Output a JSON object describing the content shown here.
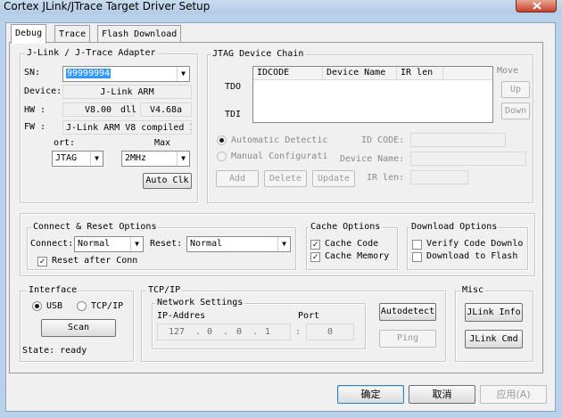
{
  "window": {
    "title": "Cortex JLink/JTrace Target Driver Setup"
  },
  "tabs": [
    {
      "label": "Debug",
      "active": true
    },
    {
      "label": "Trace",
      "active": false
    },
    {
      "label": "Flash Download",
      "active": false
    }
  ],
  "adapter": {
    "legend": "J-Link / J-Trace Adapter",
    "sn_label": "SN:",
    "sn_value": "99999994",
    "device_label": "Device:",
    "device_value": "J-Link ARM",
    "hw_label": "HW :",
    "hw_value": "V8.00",
    "dll_label": "dll",
    "dll_value": "V4.68a",
    "fw_label": "FW :",
    "fw_value": "J-Link ARM V8 compiled I",
    "port_label": "ort:",
    "port_value": "JTAG",
    "max_label": "Max",
    "max_value": "2MHz",
    "auto_clk": "Auto Clk"
  },
  "jtag": {
    "legend": "JTAG Device Chain",
    "columns": [
      "IDCODE",
      "Device Name",
      "IR len"
    ],
    "tdo": "TDO",
    "tdi": "TDI",
    "move_label": "Move",
    "up": "Up",
    "down": "Down",
    "auto_detect": "Automatic Detectic",
    "manual_config": "Manual Configurati",
    "id_code_label": "ID CODE:",
    "device_name_label": "Device Name:",
    "ir_len_label": "IR len:",
    "add": "Add",
    "delete": "Delete",
    "update": "Update"
  },
  "connect": {
    "legend": "Connect & Reset Options",
    "connect_label": "Connect:",
    "connect_value": "Normal",
    "reset_label": "Reset:",
    "reset_value": "Normal",
    "reset_after": "Reset after Conn",
    "reset_after_checked": true
  },
  "cache": {
    "legend": "Cache Options",
    "code": "Cache Code",
    "code_checked": true,
    "memory": "Cache Memory",
    "memory_checked": true
  },
  "download": {
    "legend": "Download Options",
    "verify": "Verify Code Downlo",
    "verify_checked": false,
    "flash": "Download to Flash",
    "flash_checked": false
  },
  "interface": {
    "legend": "Interface",
    "usb": "USB",
    "tcpip": "TCP/IP",
    "selected": "USB",
    "scan": "Scan",
    "state": "State: ready"
  },
  "tcp": {
    "legend": "TCP/IP",
    "net_legend": "Network Settings",
    "ip_label": "IP-Addres",
    "port_label": "Port",
    "ip": [
      "127",
      "0",
      "0",
      "1"
    ],
    "port": "0",
    "autodetect": "Autodetect",
    "ping": "Ping"
  },
  "misc": {
    "legend": "Misc",
    "info": "JLink Info",
    "cmd": "JLink Cmd"
  },
  "dialog": {
    "ok": "确定",
    "cancel": "取消",
    "apply": "应用(A)"
  }
}
